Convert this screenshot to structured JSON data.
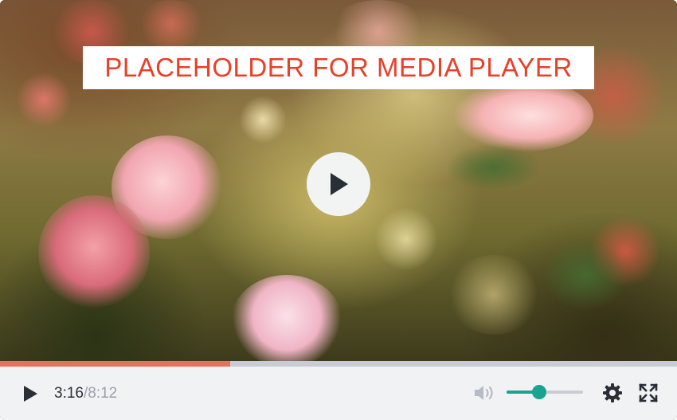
{
  "banner": {
    "text": "PLACEHOLDER FOR MEDIA PLAYER"
  },
  "playback": {
    "current_time": "3:16",
    "separator": "/",
    "duration": "8:12",
    "progress_fraction": 0.34,
    "volume_fraction": 0.43
  },
  "colors": {
    "banner_text": "#e8402a",
    "progress_fill": "#e2735e",
    "volume_accent": "#1aa38e",
    "control_bar_bg": "#f1f2f4"
  },
  "icons": {
    "big_play": "play-icon",
    "small_play": "play-icon",
    "volume": "volume-icon",
    "settings": "gear-icon",
    "fullscreen": "fullscreen-icon"
  }
}
